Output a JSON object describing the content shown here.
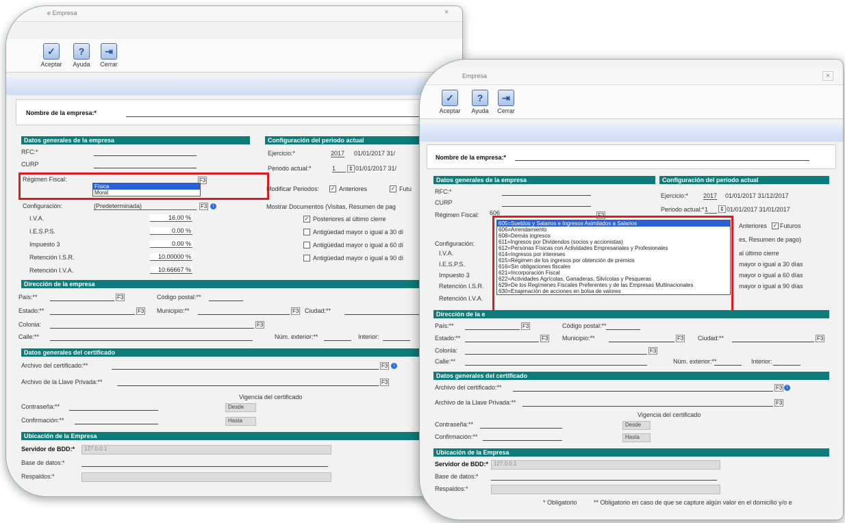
{
  "dialog_left": {
    "title": "e Empresa",
    "close": "×",
    "toolbar": {
      "accept": "Aceptar",
      "help": "Ayuda",
      "close": "Cerrar"
    },
    "company_name_label": "Nombre de la empresa:*",
    "general": {
      "header": "Datos generales de la empresa",
      "rfc_label": "RFC:*",
      "curp_label": "CURP",
      "regimen_label": "Régimen Fiscal:",
      "regimen_options": [
        "Física",
        "Moral"
      ],
      "config_label": "Configuración:",
      "config_value": "(Predeterminada)",
      "iva_label": "I.V.A.",
      "iva_value": "16.00 %",
      "ieps_label": "I.E.S.P.S.",
      "ieps_value": "0.00 %",
      "imp3_label": "Impuesto 3",
      "imp3_value": "0.00 %",
      "ret_isr_label": "Retención I.S.R.",
      "ret_isr_value": "10.00000 %",
      "ret_iva_label": "Retención I.V.A.",
      "ret_iva_value": "10.66667 %"
    },
    "period": {
      "header": "Configuración del periodo actual",
      "ejercicio_label": "Ejercicio:*",
      "ejercicio_value": "2017",
      "ejercicio_dates": "01/01/2017  31/",
      "periodo_label": "Periodo actual:*",
      "periodo_value": "1",
      "periodo_dates": "01/01/2017  31/",
      "modify_label": "Modificar Periodos:",
      "anteriores": "Anteriores",
      "futuros": "Futu",
      "show_docs": "Mostrar Documentos (Visitas, Resumen de pag",
      "opt1": "Posteriores al último cierre",
      "opt2": "Antigüedad mayor o igual a 30 dí",
      "opt3": "Antigüedad mayor o igual a 60 dí",
      "opt4": "Antigüedad mayor o igual a 90 dí"
    },
    "address": {
      "header": "Dirección de la empresa",
      "pais": "País:**",
      "cp": "Código postal:**",
      "estado": "Estado:**",
      "municipio": "Municipio:**",
      "ciudad": "Ciudad:**",
      "colonia": "Colonia:",
      "calle": "Calle:**",
      "num_ext": "Núm. exterior:**",
      "interior": "Interior:"
    },
    "cert": {
      "header": "Datos generales del certificado",
      "archivo": "Archivo del certificado:**",
      "llave": "Archivo de la Llave Privada:**",
      "vigencia": "Vigencia del certificado",
      "password": "Contraseña:**",
      "confirm": "Confirmación:**",
      "desde": "Desde",
      "hasta": "Hasta"
    },
    "location": {
      "header": "Ubicación de la Empresa",
      "server_label": "Servidor de BDD:*",
      "server_value": "127.0.0.1",
      "db_label": "Base de datos:*",
      "backup_label": "Respaldos:*"
    },
    "f3": "F3"
  },
  "dialog_right": {
    "title": "Empresa",
    "close": "×",
    "toolbar": {
      "accept": "Aceptar",
      "help": "Ayuda",
      "close": "Cerrar"
    },
    "company_name_label": "Nombre de la empresa:*",
    "general_header": "Datos generales de la empresa",
    "period_header": "Configuración del periodo actual",
    "rfc_label": "RFC:*",
    "curp_label": "CURP",
    "regimen_label": "Régimen Fiscal:",
    "regimen_code": "606",
    "ejercicio_label": "Ejercicio:*",
    "ejercicio_value": "2017",
    "ejercicio_dates": "01/01/2017  31/12/2017",
    "periodo_label": "Periodo actual:*",
    "periodo_value": "1",
    "periodo_dates": "01/01/2017  31/01/2017",
    "anteriores": "Anteriores",
    "futuros": "Futuros",
    "config_label": "Configuración:",
    "iva_label": "I.V.A.",
    "ieps_label": "I.E.S.P.S.",
    "imp3_label": "Impuesto 3",
    "ret_isr_label": "Retención I.S.R.",
    "ret_iva_label": "Retención I.V.A.",
    "resumen": "es, Resumen de pago)",
    "ultimo": "al último cierre",
    "opt30": "mayor o igual a 30 días",
    "opt60": "mayor o igual a 60 días",
    "opt90": "mayor o igual a 90 días",
    "regimen_options": [
      "605=Sueldos y Salarios e Ingresos Asimilados a Salarios",
      "606=Arrendamiento",
      "608=Demás ingresos",
      "611=Ingresos por Dividendos (socios y accionistas)",
      "612=Personas Físicas con Actividades Empresariales y Profesionales",
      "614=Ingresos por intereses",
      "615=Régimen de los ingresos por obtención de premios",
      "616=Sin obligaciones fiscales",
      "621=Incorporación Fiscal",
      "622=Actividades Agrícolas, Ganaderas, Silvícolas y Pesqueras",
      "629=De los Regímenes Fiscales Preferentes y de las Empresas Multinacionales",
      "630=Enajenación de acciones en bolsa de valores"
    ],
    "address": {
      "header": "Dirección de la e",
      "pais": "País:**",
      "cp": "Código postal:**",
      "estado": "Estado:**",
      "municipio": "Municipio:**",
      "ciudad": "Ciudad:**",
      "colonia": "Colonia:",
      "calle": "Calle:**",
      "num_ext": "Núm. exterior:**",
      "interior": "Interior:"
    },
    "cert": {
      "header": "Datos generales del certificado",
      "archivo": "Archivo del certificado:**",
      "llave": "Archivo de la Llave Privada:**",
      "vigencia": "Vigencia del certificado",
      "password": "Contraseña:**",
      "confirm": "Confirmación:**",
      "desde": "Desde",
      "hasta": "Hasta"
    },
    "location": {
      "header": "Ubicación de la Empresa",
      "server_label": "Servidor de BDD:*",
      "server_value": "127.0.0.1",
      "db_label": "Base de datos:*",
      "backup_label": "Respaldos:*"
    },
    "footer": {
      "obligatorio": "* Obligatorio",
      "obligatorio2": "** Obligatorio en caso de que se capture algún valor en el domicilio y/o e"
    },
    "f3": "F3"
  }
}
